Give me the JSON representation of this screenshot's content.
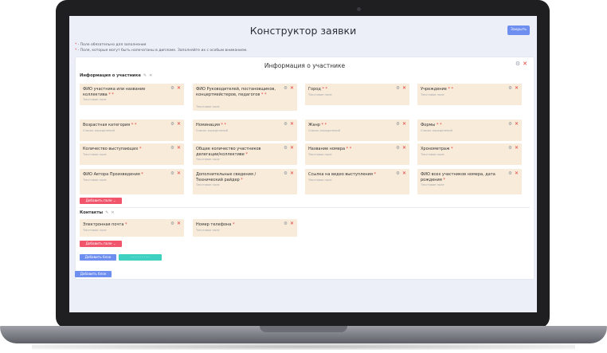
{
  "header": {
    "title": "Конструктор заявки",
    "save_label": "Закрыть"
  },
  "notes": {
    "line1_mark": "*",
    "line1_text": " - Поле обязательно для заполнения",
    "line2_mark": "*",
    "line2_text": " - Поля, которые могут быть напечатаны в дипломе. Заполняйте их с особым вниманием."
  },
  "panel": {
    "title": "Информация о участнике"
  },
  "sections": [
    {
      "title": "Информация о участнике",
      "fields": [
        {
          "label": "ФИО участника или название коллектива",
          "req": " * *",
          "placeholder": "Текстовое поле"
        },
        {
          "label": "ФИО Руководителей, постановщиков, концертмейстеров, педагогов",
          "req": " * *",
          "placeholder": "Текстовое поле"
        },
        {
          "label": "Город",
          "req": " * *",
          "placeholder": "Текстовое поле"
        },
        {
          "label": "Учреждение",
          "req": " * *",
          "placeholder": "Текстовое поле"
        },
        {
          "label": "Возрастная категория",
          "req": " * *",
          "placeholder": "Список определений"
        },
        {
          "label": "Номинация",
          "req": " * *",
          "placeholder": "Список определений"
        },
        {
          "label": "Жанр",
          "req": " * *",
          "placeholder": "Список определений"
        },
        {
          "label": "Формы",
          "req": " * *",
          "placeholder": "Список определений"
        },
        {
          "label": "Количество выступающих",
          "req": " *",
          "placeholder": "Текстовое поле"
        },
        {
          "label": "Общее количество участников делегации/коллективе",
          "req": " *",
          "placeholder": "Текстовое поле"
        },
        {
          "label": "Название номера",
          "req": " * *",
          "placeholder": "Текстовое поле"
        },
        {
          "label": "Хронометраж",
          "req": " *",
          "placeholder": "Текстовое поле"
        },
        {
          "label": "ФИО Автора Произведения",
          "req": " *",
          "placeholder": "Текстовое поле"
        },
        {
          "label": "Дополнительные сведения / Технический райдер",
          "req": " *",
          "placeholder": "Текстовое поле"
        },
        {
          "label": "Ссылка на видео выступления",
          "req": " *",
          "placeholder": "Текстовое поле"
        },
        {
          "label": "ФИО всех участников номера, дата рождения",
          "req": " *",
          "placeholder": "Текстовое поле"
        }
      ],
      "add_field_label": "Добавить поле ⌄"
    },
    {
      "title": "Контакты",
      "fields": [
        {
          "label": "Электронная почта",
          "req": " *",
          "placeholder": "Текстовое поле"
        },
        {
          "label": "Номер телефона",
          "req": " *",
          "placeholder": "Текстовое поле"
        }
      ],
      "add_field_label": "Добавить поле ⌄"
    }
  ],
  "buttons": {
    "add_block_inner": "Добавить блок",
    "teal_label": "- - - - - - - - -",
    "add_block_outer": "Добавить блок"
  },
  "icons": {
    "gear": "⚙",
    "close": "✕",
    "edit": "✎"
  },
  "colors": {
    "accent": "#6f8ff0",
    "danger": "#f0556b",
    "field_bg": "#f8ebd9",
    "teal": "#3ed1c2"
  }
}
